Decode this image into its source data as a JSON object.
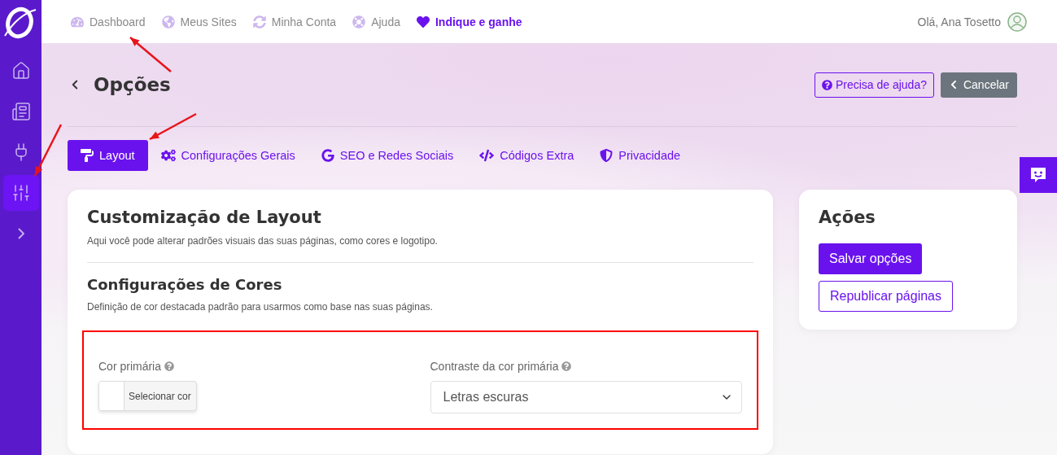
{
  "sidebar": {
    "items": [
      {
        "kind": "home",
        "selected": false
      },
      {
        "kind": "pages",
        "selected": false
      },
      {
        "kind": "plug",
        "selected": false
      },
      {
        "kind": "sliders",
        "selected": true
      },
      {
        "kind": "expand",
        "selected": false
      }
    ]
  },
  "topnav": {
    "items": [
      {
        "kind": "dashboard",
        "label": "Dashboard",
        "highlighted": false
      },
      {
        "kind": "globe",
        "label": "Meus Sites",
        "highlighted": false
      },
      {
        "kind": "sync",
        "label": "Minha Conta",
        "highlighted": false
      },
      {
        "kind": "help",
        "label": "Ajuda",
        "highlighted": false
      },
      {
        "kind": "heart",
        "label": "Indique e ganhe",
        "highlighted": true
      }
    ],
    "greeting": "Olá, Ana Tosetto"
  },
  "page": {
    "title": "Opções",
    "help_button": "Precisa de ajuda?",
    "cancel_button": "Cancelar"
  },
  "tabs": [
    {
      "kind": "roller",
      "label": "Layout",
      "selected": true
    },
    {
      "kind": "cogs",
      "label": "Configurações Gerais",
      "selected": false
    },
    {
      "kind": "google",
      "label": "SEO e Redes Sociais",
      "selected": false
    },
    {
      "kind": "code",
      "label": "Códigos Extra",
      "selected": false
    },
    {
      "kind": "shield",
      "label": "Privacidade",
      "selected": false
    }
  ],
  "layout_card": {
    "title": "Customização de Layout",
    "description": "Aqui você pode alterar padrões visuais das suas páginas, como cores e logotipo.",
    "section_title": "Configurações de Cores",
    "section_description": "Definição de cor destacada padrão para usarmos como base nas suas páginas.",
    "highlighted": true,
    "fields": [
      {
        "kind": "color",
        "label": "Cor primária",
        "button": "Selecionar cor"
      },
      {
        "kind": "select",
        "label": "Contraste da cor primária",
        "value": "Letras escuras"
      }
    ]
  },
  "actions": {
    "title": "Ações",
    "primary": "Salvar opções",
    "secondary": "Republicar páginas"
  }
}
